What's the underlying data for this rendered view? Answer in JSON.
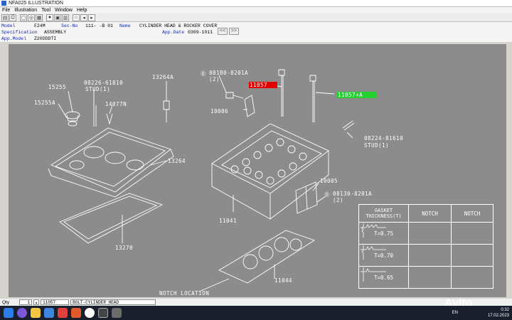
{
  "window": {
    "title": "NFA025  ILLUSTRATION"
  },
  "menu": [
    "File",
    "Illustration",
    "Tool",
    "Window",
    "Help"
  ],
  "toolbar_icons": [
    "open-icon",
    "print-icon",
    "zoom-icon",
    "search-icon",
    "settings-icon",
    "color-icon",
    "grid-icon",
    "info-icon",
    "home-icon",
    "back-icon",
    "forward-icon"
  ],
  "info": {
    "model_label": "Model",
    "model_value": "F24M",
    "secno_label": "Sec-No",
    "secno_value": "111-  -B 01",
    "name_label": "Name",
    "name_value": "CYLINDER HEAD & ROCKER COVER",
    "spec_label": "Specification",
    "spec_value": "ASSEMBLY",
    "appdate_label": "App.Date",
    "appdate_value": "0309-1011",
    "appmodel_label": "App.Model",
    "appmodel_value": "Z20DDDTI",
    "nav_prev": "<<",
    "nav_next": ">>"
  },
  "callouts": {
    "c13264A": "13264A",
    "c15255": "15255",
    "c15255A": "15255A",
    "c08226": "08226-61810",
    "c08226_stud": "STUD(1)",
    "c14077N": "14077N",
    "c13264": "13264",
    "c13270": "13270",
    "c081B0": "081B0-8201A",
    "c081B0_qty": "(2)",
    "c11057": "11057",
    "c11057A": "11057+A",
    "c10006": "10006",
    "c08224": "08224-81610",
    "c08224_stud": "STUD(1)",
    "c10005": "10005",
    "c08130": "08130-8201A",
    "c08130_qty": "(2)",
    "c11041": "11041",
    "c11044": "11044",
    "notch": "NOTCH LOCATION",
    "bullet": "B"
  },
  "highlight_colors": {
    "selected": "#e00000",
    "related": "#23d12f"
  },
  "gasket_table": {
    "header_col1": "GASKET THICKNESS(T)",
    "header_col2": "NOTCH",
    "header_col3": "NOTCH",
    "rows": [
      {
        "thickness": "T=0.75"
      },
      {
        "thickness": "T=0.70"
      },
      {
        "thickness": "T=0.65"
      }
    ]
  },
  "status": {
    "qty_label": "Qty",
    "qty_value": "1",
    "part_no": "11057",
    "part_name": "BOLT-CYLINDER HEAD"
  },
  "taskbar": {
    "lang": "EN",
    "time": "0:32",
    "date": "17.02.2023"
  },
  "watermark": "Avito"
}
